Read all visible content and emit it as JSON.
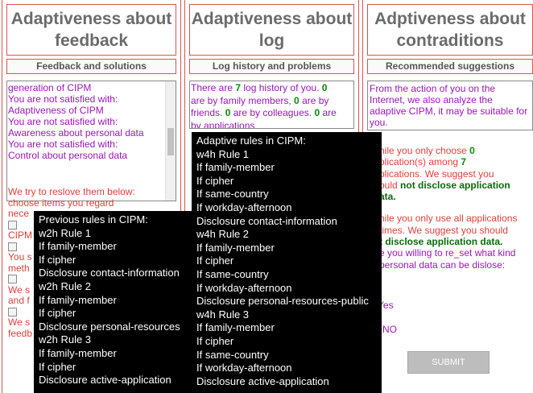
{
  "columns": {
    "feedback": {
      "title": "Adaptiveness about feedback",
      "subtitle": "Feedback and solutions",
      "lines": [
        "generation of CIPM",
        "You are not satisfied with:",
        "Adaptiveness of CIPM",
        "You are not satisfied with:",
        "Awareness about personal data",
        "You are not satisfied with:",
        "Control about personal data"
      ],
      "try_line1": "We try to reslove them below:",
      "try_line2": "choose items you regard",
      "frag1": "nece",
      "frag2": "CIPM",
      "frag3": "You s",
      "frag4": "meth",
      "frag5": "We s",
      "frag6": "and f",
      "frag7": "We s",
      "frag8": "feedb"
    },
    "log": {
      "title": "Adaptiveness about log",
      "subtitle": "Log history and problems",
      "t1": "There are ",
      "n_total": "7",
      "t2": " log history of you. ",
      "n_family": "0",
      "t3": "are by family members, ",
      "n_friends": "0",
      "t4": " are by",
      "t5": "friends. ",
      "n_colleagues": "0",
      "t6": " are by colleagues. ",
      "n_other": "0",
      "t7": " are",
      "t8": "by applications"
    },
    "contra": {
      "title": "Adptiveness about contraditions",
      "subtitle": "Recommended suggestions",
      "p1": "From the action of you on the Internet, we also analyze the adaptive CIPM, it may be suitable for you.",
      "p2a": "hile you only choose ",
      "p2n": "0",
      "p3a": "plication(s) among ",
      "p3n": "7",
      "p4": "plications. We suggest you",
      "p5a": "ould ",
      "p5b": "not disclose application",
      "p6": "ata.",
      "p7": "hile you only use all applications",
      "p8": "times. We suggest you should",
      "p9": "t disclose application data.",
      "p10": "e you willing to re_set what kind",
      "p11": "personal data can be dislose:",
      "yes": "Yes",
      "no": "NO",
      "submit": "SUBMIT"
    }
  },
  "tooltip_adaptive": {
    "lines": [
      "Adaptive rules in CIPM:",
      "w4h Rule 1",
      "If family-member",
      "If cipher",
      "If same-country",
      "If workday-afternoon",
      "Disclosure contact-information",
      "w4h Rule 2",
      "If family-member",
      "If cipher",
      "If same-country",
      "If workday-afternoon",
      "Disclosure personal-resources-public",
      "w4h Rule 3",
      "If family-member",
      "If cipher",
      "If same-country",
      "If workday-afternoon",
      "Disclosure active-application"
    ]
  },
  "tooltip_previous": {
    "lines": [
      "Previous rules in CIPM:",
      "w2h Rule 1",
      "If family-member",
      "If cipher",
      "Disclosure contact-information",
      "w2h Rule 2",
      "If family-member",
      "If cipher",
      "Disclosure personal-resources",
      "w2h Rule 3",
      "If family-member",
      "If cipher",
      "Disclosure active-application"
    ]
  }
}
